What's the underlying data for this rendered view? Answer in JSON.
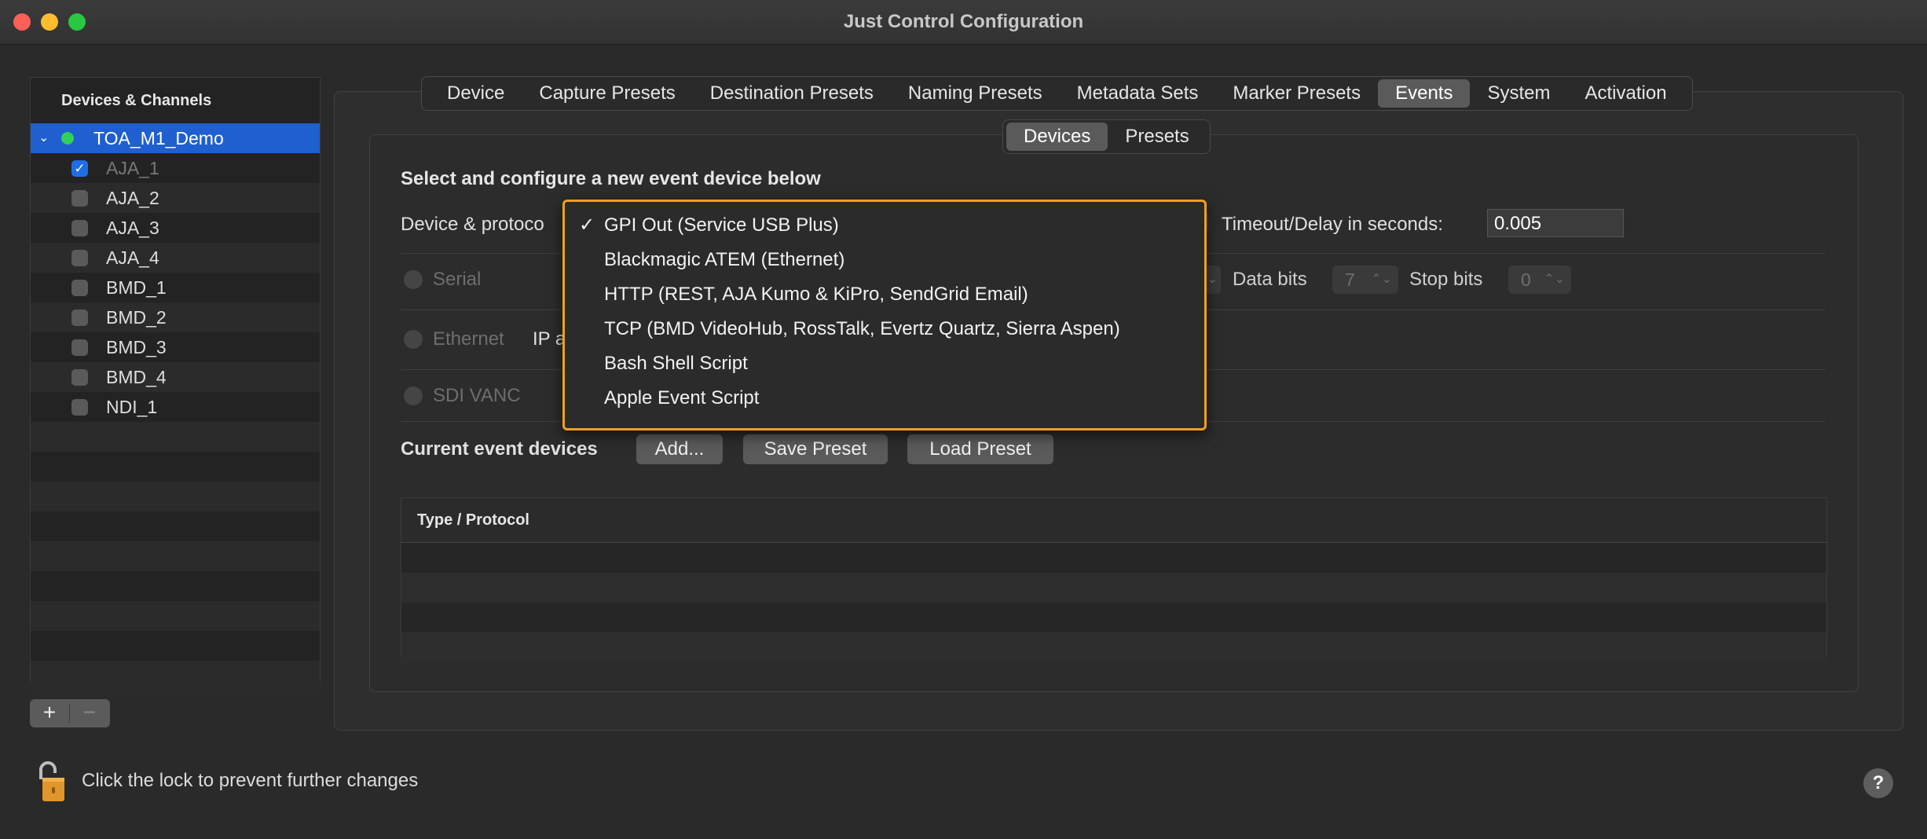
{
  "window": {
    "title": "Just Control Configuration"
  },
  "sidebar": {
    "header": "Devices & Channels",
    "root": {
      "label": "TOA_M1_Demo",
      "status_color": "#2fd158"
    },
    "channels": [
      {
        "label": "AJA_1",
        "checked": true,
        "dimmed": true
      },
      {
        "label": "AJA_2",
        "checked": false,
        "dimmed": false
      },
      {
        "label": "AJA_3",
        "checked": false,
        "dimmed": false
      },
      {
        "label": "AJA_4",
        "checked": false,
        "dimmed": false
      },
      {
        "label": "BMD_1",
        "checked": false,
        "dimmed": false
      },
      {
        "label": "BMD_2",
        "checked": false,
        "dimmed": false
      },
      {
        "label": "BMD_3",
        "checked": false,
        "dimmed": false
      },
      {
        "label": "BMD_4",
        "checked": false,
        "dimmed": false
      },
      {
        "label": "NDI_1",
        "checked": false,
        "dimmed": false
      }
    ],
    "add_label": "+",
    "remove_label": "−"
  },
  "tabs": [
    {
      "label": "Device",
      "active": false
    },
    {
      "label": "Capture Presets",
      "active": false
    },
    {
      "label": "Destination Presets",
      "active": false
    },
    {
      "label": "Naming Presets",
      "active": false
    },
    {
      "label": "Metadata Sets",
      "active": false
    },
    {
      "label": "Marker Presets",
      "active": false
    },
    {
      "label": "Events",
      "active": true
    },
    {
      "label": "System",
      "active": false
    },
    {
      "label": "Activation",
      "active": false
    }
  ],
  "subtabs": [
    {
      "label": "Devices",
      "active": true
    },
    {
      "label": "Presets",
      "active": false
    }
  ],
  "events": {
    "section_title": "Select and configure a new event device below",
    "device_protocol_label": "Device & protoco",
    "timeout_label": "Timeout/Delay in seconds:",
    "timeout_value": "0.005",
    "serial_label": "Serial",
    "data_bits_label": "Data bits",
    "data_bits_value": "7",
    "stop_bits_label": "Stop bits",
    "stop_bits_value": "0",
    "ethernet_label": "Ethernet",
    "ip_label": "IP a",
    "sdi_label": "SDI VANC",
    "current_devices_label": "Current event devices",
    "add_button": "Add...",
    "save_preset_button": "Save Preset",
    "load_preset_button": "Load Preset",
    "table_header": "Type / Protocol",
    "dropdown": {
      "check": "✓",
      "options": [
        {
          "label": "GPI Out (Service USB Plus)",
          "selected": true
        },
        {
          "label": "Blackmagic ATEM (Ethernet)",
          "selected": false
        },
        {
          "label": "HTTP (REST, AJA Kumo & KiPro, SendGrid Email)",
          "selected": false
        },
        {
          "label": "TCP (BMD VideoHub, RossTalk, Evertz Quartz, Sierra Aspen)",
          "selected": false
        },
        {
          "label": "Bash Shell Script",
          "selected": false
        },
        {
          "label": "Apple Event Script",
          "selected": false
        }
      ]
    }
  },
  "footer": {
    "lock_text": "Click the lock to prevent further changes",
    "help_label": "?"
  },
  "colors": {
    "accent": "#1f5fd0",
    "menu_highlight_border": "#f0a020"
  }
}
